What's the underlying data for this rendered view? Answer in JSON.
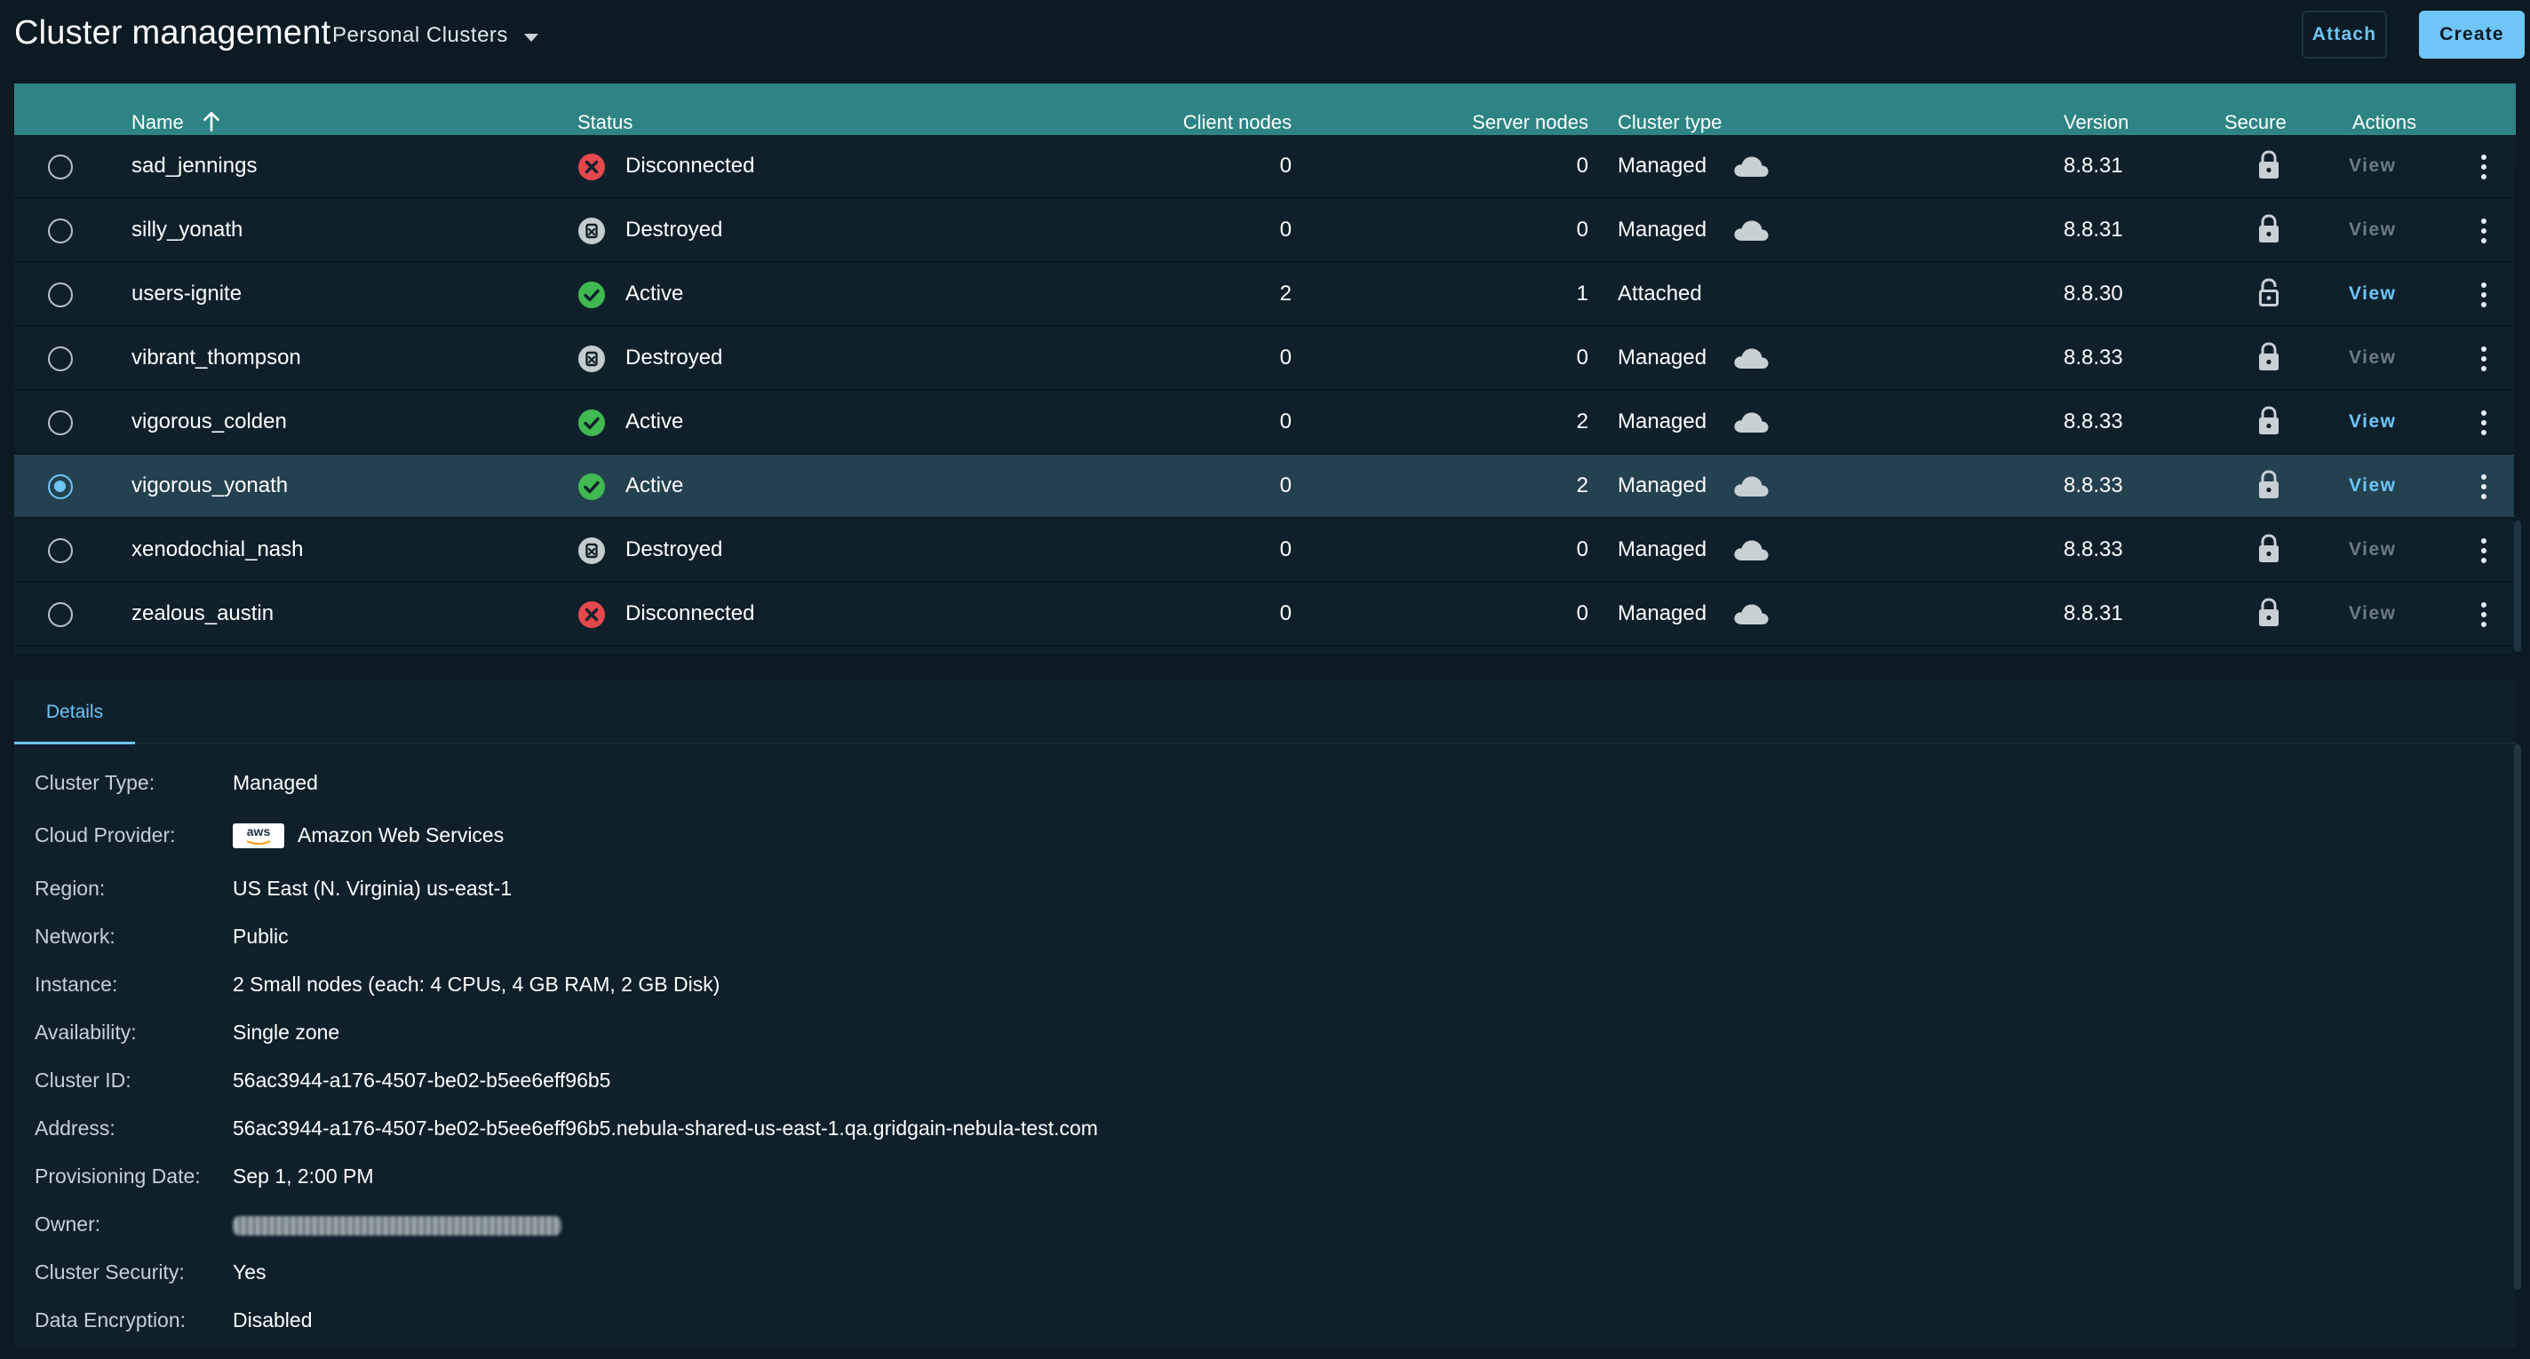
{
  "header": {
    "title": "Cluster management",
    "scope": "Personal Clusters",
    "attach_label": "Attach",
    "create_label": "Create"
  },
  "table": {
    "columns": {
      "name": "Name",
      "status": "Status",
      "client_nodes": "Client nodes",
      "server_nodes": "Server nodes",
      "cluster_type": "Cluster type",
      "version": "Version",
      "secure": "Secure",
      "actions": "Actions"
    },
    "sort": {
      "column": "name",
      "direction": "ascending"
    },
    "selected_row": "vigorous_yonath",
    "rows": [
      {
        "name": "sad_jennings",
        "status": "Disconnected",
        "status_icon": "error-icon",
        "client_nodes": "0",
        "server_nodes": "0",
        "cluster_type": "Managed",
        "cloud": true,
        "version": "8.8.31",
        "secure": "locked",
        "view_label": "View",
        "view_enabled": false
      },
      {
        "name": "silly_yonath",
        "status": "Destroyed",
        "status_icon": "destroyed-icon",
        "client_nodes": "0",
        "server_nodes": "0",
        "cluster_type": "Managed",
        "cloud": true,
        "version": "8.8.31",
        "secure": "locked",
        "view_label": "View",
        "view_enabled": false
      },
      {
        "name": "users-ignite",
        "status": "Active",
        "status_icon": "check-icon",
        "client_nodes": "2",
        "server_nodes": "1",
        "cluster_type": "Attached",
        "cloud": false,
        "version": "8.8.30",
        "secure": "unlocked",
        "view_label": "View",
        "view_enabled": true
      },
      {
        "name": "vibrant_thompson",
        "status": "Destroyed",
        "status_icon": "destroyed-icon",
        "client_nodes": "0",
        "server_nodes": "0",
        "cluster_type": "Managed",
        "cloud": true,
        "version": "8.8.33",
        "secure": "locked",
        "view_label": "View",
        "view_enabled": false
      },
      {
        "name": "vigorous_colden",
        "status": "Active",
        "status_icon": "check-icon",
        "client_nodes": "0",
        "server_nodes": "2",
        "cluster_type": "Managed",
        "cloud": true,
        "version": "8.8.33",
        "secure": "locked",
        "view_label": "View",
        "view_enabled": true
      },
      {
        "name": "vigorous_yonath",
        "status": "Active",
        "status_icon": "check-icon",
        "client_nodes": "0",
        "server_nodes": "2",
        "cluster_type": "Managed",
        "cloud": true,
        "version": "8.8.33",
        "secure": "locked",
        "view_label": "View",
        "view_enabled": true
      },
      {
        "name": "xenodochial_nash",
        "status": "Destroyed",
        "status_icon": "destroyed-icon",
        "client_nodes": "0",
        "server_nodes": "0",
        "cluster_type": "Managed",
        "cloud": true,
        "version": "8.8.33",
        "secure": "locked",
        "view_label": "View",
        "view_enabled": false
      },
      {
        "name": "zealous_austin",
        "status": "Disconnected",
        "status_icon": "error-icon",
        "client_nodes": "0",
        "server_nodes": "0",
        "cluster_type": "Managed",
        "cloud": true,
        "version": "8.8.31",
        "secure": "locked",
        "view_label": "View",
        "view_enabled": false
      }
    ]
  },
  "details": {
    "tab_label": "Details",
    "aws_logo_text": "aws",
    "fields": [
      {
        "label": "Cluster Type:",
        "value": "Managed"
      },
      {
        "label": "Cloud Provider:",
        "value": "Amazon Web Services",
        "logo": "aws-logo"
      },
      {
        "label": "Region:",
        "value": "US East (N. Virginia) us-east-1"
      },
      {
        "label": "Network:",
        "value": "Public"
      },
      {
        "label": "Instance:",
        "value": "2 Small nodes (each: 4 CPUs, 4 GB RAM, 2 GB Disk)"
      },
      {
        "label": "Availability:",
        "value": "Single zone"
      },
      {
        "label": "Cluster ID:",
        "value": "56ac3944-a176-4507-be02-b5ee6eff96b5"
      },
      {
        "label": "Address:",
        "value": "56ac3944-a176-4507-be02-b5ee6eff96b5.nebula-shared-us-east-1.qa.gridgain-nebula-test.com"
      },
      {
        "label": "Provisioning Date:",
        "value": "Sep 1, 2:00 PM"
      },
      {
        "label": "Owner:",
        "value": "",
        "redacted": true
      },
      {
        "label": "Cluster Security:",
        "value": "Yes"
      },
      {
        "label": "Data Encryption:",
        "value": "Disabled"
      }
    ]
  },
  "colors": {
    "background": "#0b1a23",
    "panel": "#0f202b",
    "header_row": "#2e8484",
    "selected_row": "#24414f",
    "accent": "#6ec6f7",
    "active": "#3fb950",
    "error": "#e5484d",
    "muted": "#6d7c84"
  }
}
